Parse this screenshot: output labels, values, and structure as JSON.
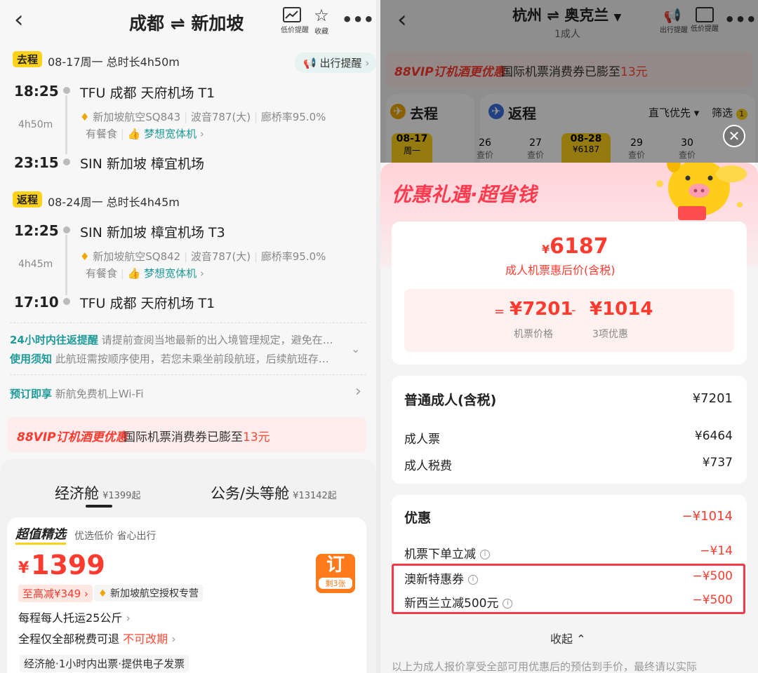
{
  "left": {
    "header": {
      "route": "成都 ⇌ 新加坡",
      "price_alert": "低价提醒",
      "favorite": "收藏"
    },
    "outbound": {
      "tag": "去程",
      "summary": "08-17周一  总时长4h50m",
      "remind_label": "出行提醒",
      "dep_time": "18:25",
      "dep_airport": "TFU  成都  天府机场  T1",
      "duration": "4h50m",
      "airline": "新加坡航空SQ843",
      "aircraft": "波音787(大)",
      "bridge": "廊桥率95.0%",
      "meal": "有餐食",
      "wide": "梦想宽体机",
      "arr_time": "23:15",
      "arr_airport": "SIN  新加坡  樟宜机场"
    },
    "return": {
      "tag": "返程",
      "summary": "08-24周一  总时长4h45m",
      "dep_time": "12:25",
      "dep_airport": "SIN  新加坡  樟宜机场  T3",
      "duration": "4h45m",
      "airline": "新加坡航空SQ842",
      "aircraft": "波音787(大)",
      "bridge": "廊桥率95.0%",
      "meal": "有餐食",
      "wide": "梦想宽体机",
      "arr_time": "17:10",
      "arr_airport": "TFU  成都  天府机场  T1"
    },
    "notices": {
      "n1_title": "24小时内往返提醒",
      "n1_text": "请提前查阅当地最新的出入境管理规定，避免在…",
      "n2_title": "使用须知",
      "n2_text": "此航班需按顺序使用，若您未乘坐前段航班，后续航班存…",
      "n3_title": "预订即享",
      "n3_text": "新航免费机上Wi-Fi"
    },
    "vip": {
      "title": "88VIP订机酒更优惠",
      "text": "国际机票消费券已膨至",
      "amount": "13元"
    },
    "cabin_tabs": [
      {
        "name": "经济舱",
        "price": "¥1399起"
      },
      {
        "name": "公务/头等舱",
        "price": "¥13142起"
      }
    ],
    "offer": {
      "badge": "超值精选",
      "slogan": "优选低价 省心出行",
      "currency": "¥",
      "price": "1399",
      "discount": "至高减¥349",
      "airline_tag": "新加坡航空授权专营",
      "baggage": "每程每人托运25公斤",
      "refund": "全程仅全部税费可退",
      "no_change": "不可改期",
      "book": "订",
      "remaining": "剩3张",
      "info": "经济舱·1小时内出票·提供电子发票"
    }
  },
  "right": {
    "header": {
      "route": "杭州 ⇌ 奥克兰",
      "passengers": "1成人",
      "notice": "出行提醒",
      "price_alert": "低价提醒"
    },
    "vip": {
      "title": "88VIP订机酒更优惠",
      "text": "国际机票消费券已膨至",
      "amount": "13元"
    },
    "tabs": {
      "outbound": "去程",
      "return": "返程",
      "direct": "直飞优先",
      "filter": "筛选",
      "filter_count": "1"
    },
    "dates": [
      {
        "d": "08-17",
        "s": "周一"
      },
      {
        "d": "26",
        "s": "查价"
      },
      {
        "d": "27",
        "s": "查价"
      },
      {
        "d": "08-28",
        "s": "¥6187"
      },
      {
        "d": "29",
        "s": "查价"
      },
      {
        "d": "30",
        "s": "查价"
      }
    ],
    "sheet": {
      "title": "优惠礼遇·超省钱",
      "currency": "¥",
      "final_price": "6187",
      "final_label": "成人机票惠后价(含税)",
      "eq": "=",
      "ticket_price": "¥7201",
      "ticket_label": "机票价格",
      "minus": "-",
      "discount_total": "¥1014",
      "discount_label": "3项优惠",
      "adult_title": "普通成人(含税)",
      "adult_total": "¥7201",
      "ticket_row": "成人票",
      "ticket_row_val": "¥6464",
      "tax_row": "成人税费",
      "tax_row_val": "¥737",
      "promo_title": "优惠",
      "promo_total": "−¥1014",
      "promo1": "机票下单立减",
      "promo1_val": "−¥14",
      "promo2": "澳新特惠券",
      "promo2_val": "−¥500",
      "promo3": "新西兰立减500元",
      "promo3_val": "−¥500",
      "collapse": "收起",
      "footer": "以上为成人报价享受全部可用优惠后的预估到手价，最终请以实际"
    }
  }
}
